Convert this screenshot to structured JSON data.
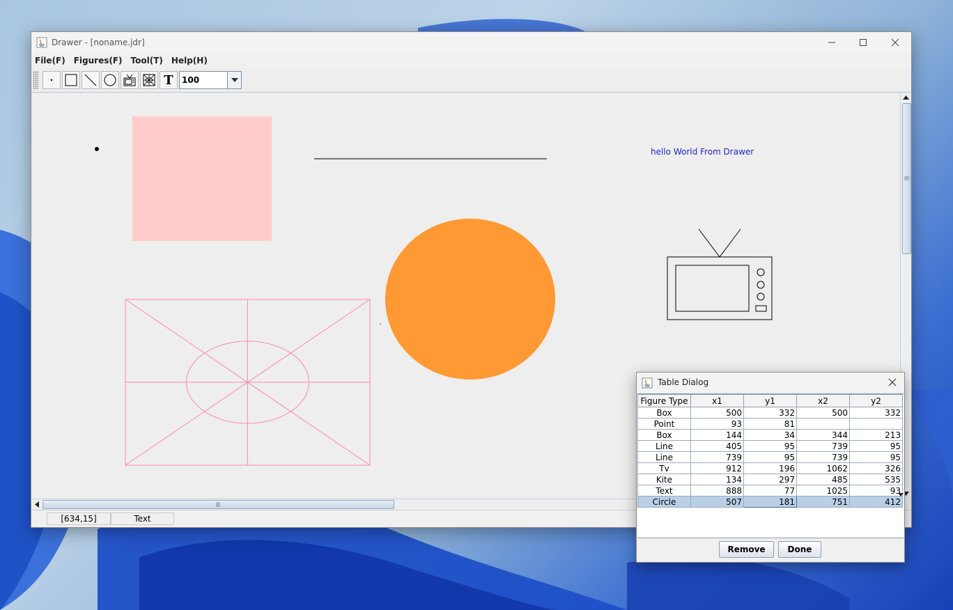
{
  "window": {
    "title": "Drawer - [noname.jdr]"
  },
  "menu": {
    "items": [
      "File(F)",
      "Figures(F)",
      "Tool(T)",
      "Help(H)"
    ]
  },
  "toolbar": {
    "tools": [
      "point-tool-icon",
      "box-tool-icon",
      "line-tool-icon",
      "circle-tool-icon",
      "tv-tool-icon",
      "kite-tool-icon",
      "text-tool-icon"
    ],
    "text_tool_glyph": "T",
    "zoom_value": "100"
  },
  "canvas": {
    "text_figure": "hello World From Drawer",
    "colors": {
      "box_fill": "#ffcccc",
      "circle_fill": "#ff9933",
      "kite_stroke": "#ff88aa",
      "text_color": "#2222cc"
    }
  },
  "statusbar": {
    "coords": "[634,15]",
    "mode": "Text"
  },
  "dialog": {
    "title": "Table Dialog",
    "columns": [
      "Figure Type",
      "x1",
      "y1",
      "x2",
      "y2"
    ],
    "rows": [
      [
        "Box",
        "500",
        "332",
        "500",
        "332"
      ],
      [
        "Point",
        "93",
        "81",
        "",
        ""
      ],
      [
        "Box",
        "144",
        "34",
        "344",
        "213"
      ],
      [
        "Line",
        "405",
        "95",
        "739",
        "95"
      ],
      [
        "Line",
        "739",
        "95",
        "739",
        "95"
      ],
      [
        "Tv",
        "912",
        "196",
        "1062",
        "326"
      ],
      [
        "Kite",
        "134",
        "297",
        "485",
        "535"
      ],
      [
        "Text",
        "888",
        "77",
        "1025",
        "93"
      ],
      [
        "Circle",
        "507",
        "181",
        "751",
        "412"
      ]
    ],
    "selected_row": 8,
    "buttons": {
      "remove": "Remove",
      "done": "Done"
    }
  }
}
